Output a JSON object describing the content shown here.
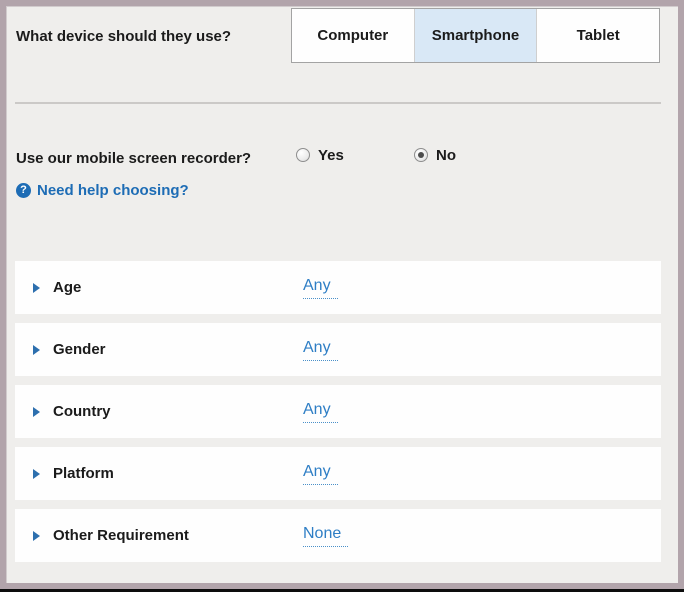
{
  "device_question": {
    "label": "What device should they use?",
    "options": [
      {
        "label": "Computer",
        "selected": false
      },
      {
        "label": "Smartphone",
        "selected": true
      },
      {
        "label": "Tablet",
        "selected": false
      }
    ]
  },
  "recorder_question": {
    "label": "Use our mobile screen recorder?",
    "options": [
      {
        "label": "Yes",
        "selected": false
      },
      {
        "label": "No",
        "selected": true
      }
    ]
  },
  "help_link": {
    "icon_glyph": "?",
    "label": "Need help choosing?"
  },
  "filters": {
    "rows": [
      {
        "label": "Age",
        "value": "Any"
      },
      {
        "label": "Gender",
        "value": "Any"
      },
      {
        "label": "Country",
        "value": "Any"
      },
      {
        "label": "Platform",
        "value": "Any"
      },
      {
        "label": "Other Requirement",
        "value": "None"
      }
    ]
  },
  "colors": {
    "frame-border": "#b2a4ab",
    "page-bg": "#efeeec",
    "row-bg": "#fefefe",
    "selected-tab-bg": "#d9e8f6",
    "link-blue": "#2e7ec5",
    "help-blue": "#1d6cb5",
    "text-dark": "#1b1b1b",
    "bottom-bar": "#0d0d0d"
  }
}
